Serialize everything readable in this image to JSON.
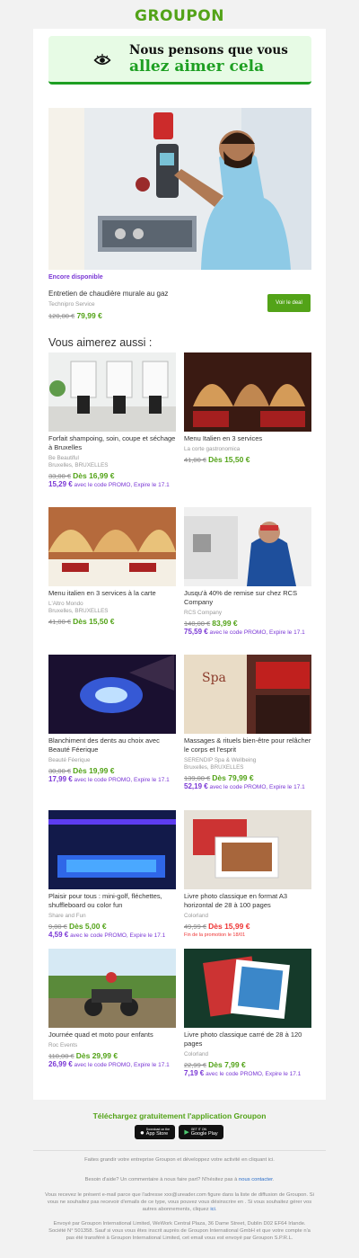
{
  "brand": {
    "logo": "GROUPON",
    "green": "#53a318",
    "purple": "#7a37d5"
  },
  "banner": {
    "line1": "Nous pensons que vous",
    "line2": "allez aimer cela",
    "icon": "eye-icon"
  },
  "hero": {
    "availability": "Encore disponible",
    "title": "Entretien de chaudière murale au gaz",
    "merchant": "Technipro Service",
    "old_price": "120,00 €",
    "new_price": "79,99 €",
    "cta": "Voir le deal"
  },
  "section_title": "Vous aimerez aussi :",
  "deals": [
    {
      "title": "Forfait shampoing, soin, coupe et séchage à Bruxelles",
      "merchant": "Be Beautiful",
      "location": "Bruxelles, BRUXELLES",
      "old": "33,00 €",
      "new": "Dès 16,99 €",
      "promo_price": "15,29 €",
      "promo_text": "avec le code PROMO, Expire le 17.1"
    },
    {
      "title": "Menu Italien en 3 services",
      "merchant": "La corte gastronomica",
      "location": "",
      "old": "41,00 €",
      "new": "Dès 15,50 €",
      "promo_price": "",
      "promo_text": ""
    },
    {
      "title": "Menu italien en 3 services à la carte",
      "merchant": "L'Altro Mondo",
      "location": "Bruxelles, BRUXELLES",
      "old": "41,00 €",
      "new": "Dès 15,50 €",
      "promo_price": "",
      "promo_text": ""
    },
    {
      "title": "Jusqu'à 40% de remise sur chez RCS Company",
      "merchant": "RCS Company",
      "location": "",
      "old": "140,00 €",
      "new": "83,99 €",
      "promo_price": "75,59 €",
      "promo_text": "avec le code PROMO, Expire le 17.1"
    },
    {
      "title": "Blanchiment des dents au choix avec Beauté Féerique",
      "merchant": "Beauté Féerique",
      "location": "",
      "old": "30,00 €",
      "new": "Dès 19,99 €",
      "promo_price": "17,99 €",
      "promo_text": "avec le code PROMO, Expire le 17.1"
    },
    {
      "title": "Massages & rituels bien-être pour relâcher le corps et l'esprit",
      "merchant": "SERENDIP Spa & Wellbeing",
      "location": "Bruxelles, BRUXELLES",
      "old": "139,00 €",
      "new": "Dès 79,99 €",
      "promo_price": "52,19 €",
      "promo_text": "avec le code PROMO, Expire le 17.1"
    },
    {
      "title": "Plaisir pour tous : mini-golf, fléchettes, shuffleboard ou color fun",
      "merchant": "Share and Fun",
      "location": "",
      "old": "9,00 €",
      "new": "Dès 5,00 €",
      "promo_price": "4,59 €",
      "promo_text": "avec le code PROMO, Expire le 17.1"
    },
    {
      "title": "Livre photo classique en format A3 horizontal de 28 à 100 pages",
      "merchant": "Colorland",
      "location": "",
      "old": "49,99 €",
      "new": "Dès 15,99 €",
      "promo_price": "",
      "promo_text": "",
      "endnote": "Fin de la promotion le 18/01"
    },
    {
      "title": "Journée quad et moto pour enfants",
      "merchant": "Roc Events",
      "location": "",
      "old": "110,00 €",
      "new": "Dès 29,99 €",
      "promo_price": "26,99 €",
      "promo_text": "avec le code PROMO, Expire le 17.1"
    },
    {
      "title": "Livre photo classique carré de 28 à 120 pages",
      "merchant": "Colorland",
      "location": "",
      "old": "22,99 €",
      "new": "Dès 7,99 €",
      "promo_price": "7,19 €",
      "promo_text": "avec le code PROMO, Expire le 17.1"
    }
  ],
  "app": {
    "title": "Téléchargez gratuitement l'application Groupon",
    "appstore": "App Store",
    "googleplay": "Google Play",
    "appstore_small": "Download on the",
    "googleplay_small": "GET IT ON"
  },
  "footer": {
    "grow": "Faites grandir votre entreprise Groupon et développez votre activité en cliquant ici.",
    "help": "Besoin d'aide? Un commentaire à nous faire part? N'hésitez pas à",
    "help_link": "nous contacter",
    "legal1": "Vous recevez le présent e-mail parce que l'adresse xxx@ureader.com figure dans la liste de diffusion de Groupon. Si vous ne souhaitez pas recevoir d'emails de ce type, vous pouvez vous désinscrire en . Si vous souhaitez gérer vos autres abonnements, cliquez",
    "legal1_link": "ici",
    "legal2": "Envoyé par Groupon International Limited, WeWork Central Plaza, 36 Dame Street, Dublin D02 EF64 Irlande. Société N° 501358. Sauf si vous vous êtes inscrit auprès de Groupon International GmbH et que votre compte n'a pas été transféré à Groupon International Limited, cet email vous est envoyé par Groupon S.P.R.L."
  }
}
